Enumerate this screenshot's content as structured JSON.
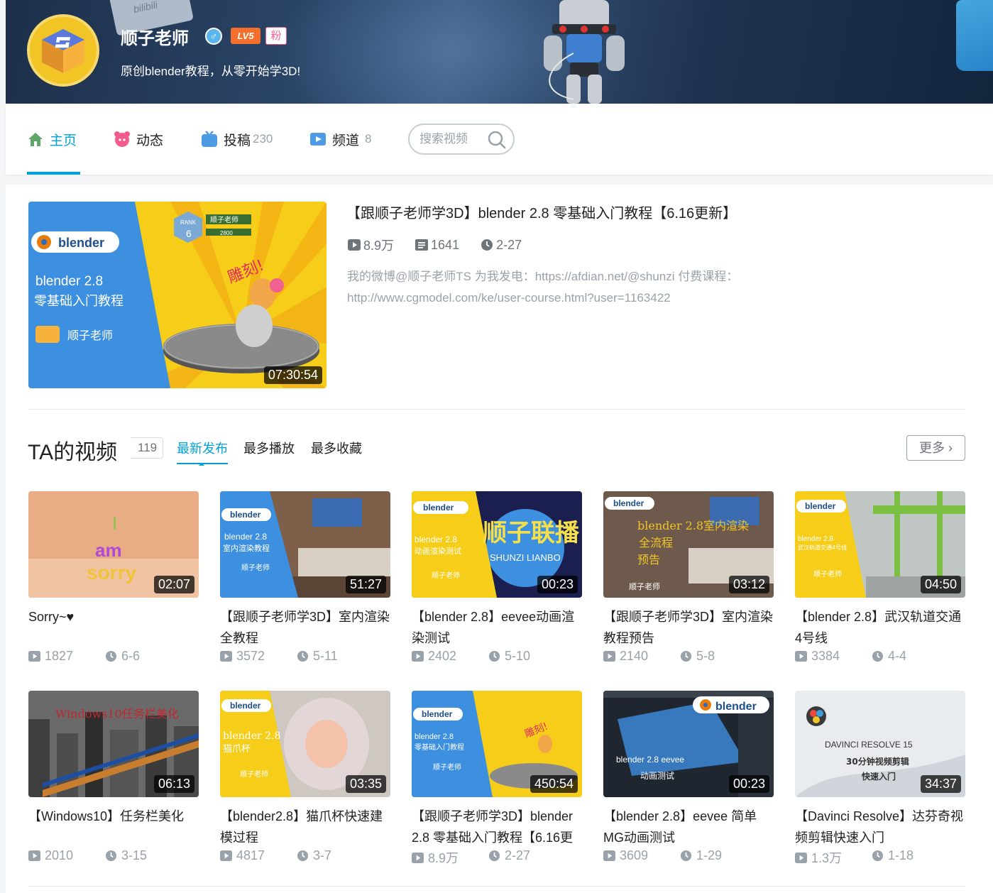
{
  "profile": {
    "name": "顺子老师",
    "level": "LV5",
    "fan_badge": "粉",
    "sign": "原创blender教程，从零开始学3D!"
  },
  "nav": {
    "home": "主页",
    "dynamic": "动态",
    "videos": "投稿",
    "videos_count": "230",
    "channels": "频道",
    "channels_count": "8",
    "search_placeholder": "搜索视频"
  },
  "featured": {
    "title": "【跟顺子老师学3D】blender 2.8 零基础入门教程【6.16更新】",
    "plays": "8.9万",
    "comments": "1641",
    "date": "2-27",
    "desc": "我的微博@顺子老师TS 为我发电：https://afdian.net/@shunzi 付费课程：http://www.cgmodel.com/ke/user-course.html?user=1163422",
    "duration": "07:30:54",
    "thumb_text": {
      "logo": "blender",
      "line1": "blender 2.8",
      "line2": "零基础入门教程",
      "author": "顺子老师",
      "carve": "雕刻!",
      "rank": "RANK",
      "rank_num": "6",
      "rank_name": "顺子老师",
      "rank_score": "2800"
    }
  },
  "section": {
    "title": "TA的视频",
    "count": "119",
    "tabs": [
      "最新发布",
      "最多播放",
      "最多收藏"
    ],
    "more": "更多"
  },
  "videos": [
    {
      "title": "Sorry~♥",
      "plays": "1827",
      "date": "6-6",
      "duration": "02:07",
      "thumb_words": [
        "I",
        "am",
        "sorry"
      ]
    },
    {
      "title": "【跟顺子老师学3D】室内渲染全教程",
      "plays": "3572",
      "date": "5-11",
      "duration": "51:27",
      "thumb_words": [
        "blender",
        "blender 2.8",
        "室内渲染教程",
        "顺子老师"
      ]
    },
    {
      "title": "【blender 2.8】eevee动画渲染测试",
      "plays": "2402",
      "date": "5-10",
      "duration": "00:23",
      "thumb_words": [
        "blender",
        "blender 2.8",
        "动画渲染测试",
        "顺子老师",
        "顺子联播",
        "SHUNZI LIANBO"
      ]
    },
    {
      "title": "【跟顺子老师学3D】室内渲染教程预告",
      "plays": "2140",
      "date": "5-8",
      "duration": "03:12",
      "thumb_words": [
        "blender",
        "blender 2.8室内渲染",
        "全流程",
        "预告",
        "顺子老师"
      ]
    },
    {
      "title": "【blender 2.8】武汉轨道交通4号线",
      "plays": "3384",
      "date": "4-4",
      "duration": "04:50",
      "thumb_words": [
        "blender",
        "blender 2.8",
        "武汉轨道交通4号线",
        "顺子老师"
      ]
    },
    {
      "title": "【Windows10】任务栏美化",
      "plays": "2010",
      "date": "3-15",
      "duration": "06:13",
      "thumb_words": [
        "Windows10任务栏美化"
      ]
    },
    {
      "title": "【blender2.8】猫爪杯快速建模过程",
      "plays": "4817",
      "date": "3-7",
      "duration": "03:35",
      "thumb_words": [
        "blender",
        "blender 2.8",
        "猫爪杯",
        "顺子老师"
      ]
    },
    {
      "title": "【跟顺子老师学3D】blender 2.8 零基础入门教程【6.16更",
      "plays": "8.9万",
      "date": "2-27",
      "duration": "450:54",
      "thumb_words": [
        "blender",
        "blender 2.8",
        "零基础入门教程",
        "顺子老师",
        "雕刻!"
      ]
    },
    {
      "title": "【blender 2.8】eevee 简单MG动画测试",
      "plays": "3609",
      "date": "1-29",
      "duration": "00:23",
      "thumb_words": [
        "blender",
        "blender 2.8 eevee",
        "动画测试"
      ]
    },
    {
      "title": "【Davinci Resolve】达芬奇视频剪辑快速入门",
      "plays": "1.3万",
      "date": "1-18",
      "duration": "34:37",
      "thumb_words": [
        "DAVINCI RESOLVE 15",
        "30分钟视频剪辑",
        "快速入门"
      ]
    }
  ],
  "colors": {
    "accent": "#00a1d6",
    "blender_blue": "#3d8fe0",
    "yellow": "#f4c81a"
  }
}
